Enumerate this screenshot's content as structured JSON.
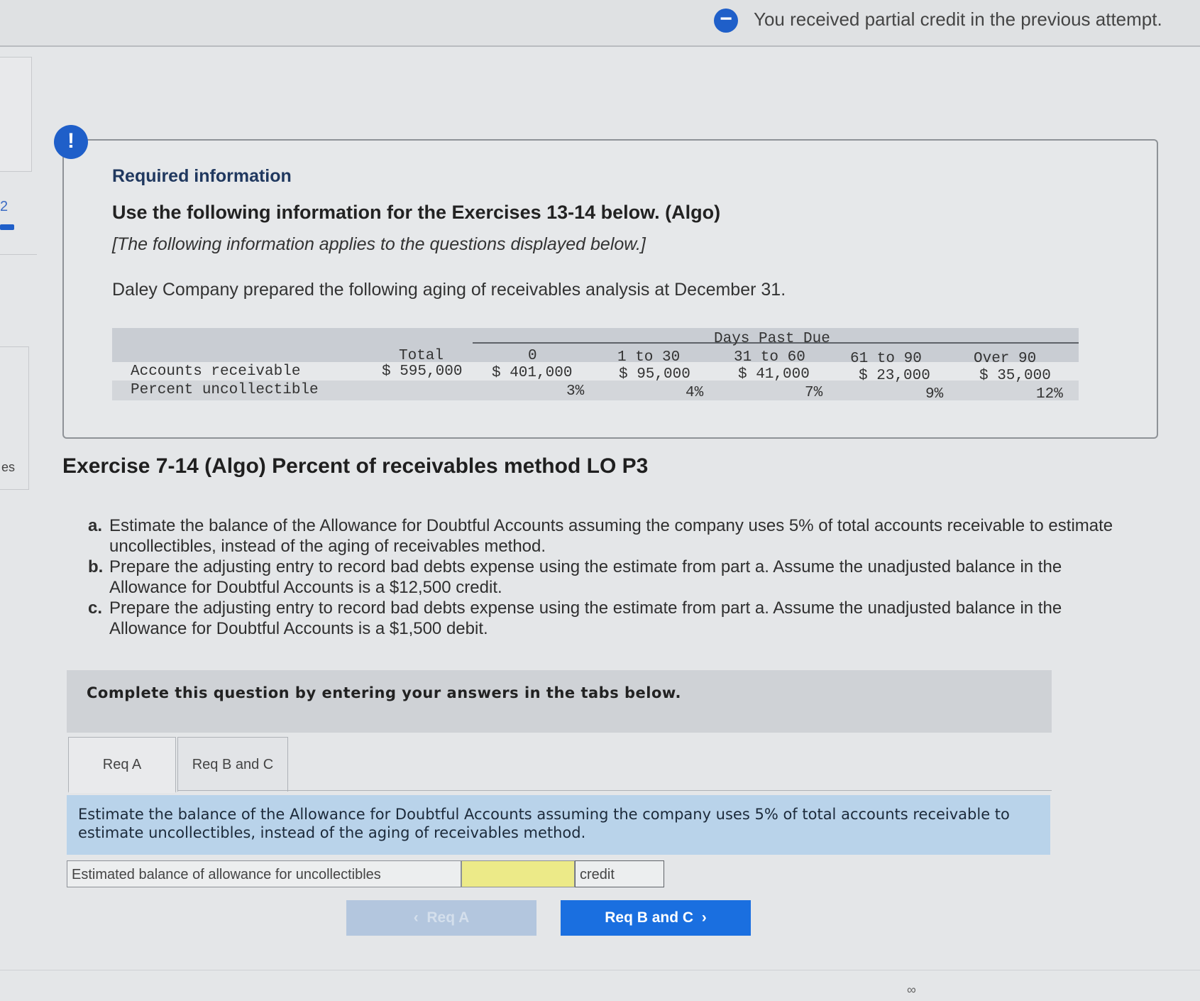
{
  "banner": {
    "icon": "minus-circle-icon",
    "icon_glyph": "−",
    "text": "You received partial credit in the previous attempt."
  },
  "sidebar": {
    "number": "2",
    "label": "es"
  },
  "info": {
    "icon_glyph": "!",
    "required": "Required information",
    "use": "Use the following information for the Exercises 13-14 below. (Algo)",
    "applies": "[The following information applies to the questions displayed below.]",
    "intro": "Daley Company prepared the following aging of receivables analysis at December 31."
  },
  "aging_table": {
    "group_header": "Days Past Due",
    "columns": [
      "Total",
      "0",
      "1 to 30",
      "31 to 60",
      "61 to 90",
      "Over 90"
    ],
    "rows": [
      {
        "label": "Accounts receivable",
        "values": [
          "$ 595,000",
          "$ 401,000",
          "$ 95,000",
          "$ 41,000",
          "$ 23,000",
          "$ 35,000"
        ]
      },
      {
        "label": "Percent uncollectible",
        "values": [
          "",
          "3%",
          "4%",
          "7%",
          "9%",
          "12%"
        ]
      }
    ]
  },
  "exercise": {
    "title": "Exercise 7-14 (Algo) Percent of receivables method LO P3",
    "parts": [
      {
        "letter": "a.",
        "text": "Estimate the balance of the Allowance for Doubtful Accounts assuming the company uses 5% of total accounts receivable to estimate uncollectibles, instead of the aging of receivables method."
      },
      {
        "letter": "b.",
        "text": "Prepare the adjusting entry to record bad debts expense using the estimate from part a. Assume the unadjusted balance in the Allowance for Doubtful Accounts is a $12,500 credit."
      },
      {
        "letter": "c.",
        "text": "Prepare the adjusting entry to record bad debts expense using the estimate from part a. Assume the unadjusted balance in the Allowance for Doubtful Accounts is a $1,500 debit."
      }
    ]
  },
  "complete_prompt": "Complete this question by entering your answers in the tabs below.",
  "tabs": [
    {
      "label": "Req A"
    },
    {
      "label": "Req B and C"
    }
  ],
  "instruction": "Estimate the balance of the Allowance for Doubtful Accounts assuming the company uses 5% of total accounts receivable to estimate uncollectibles, instead of the aging of receivables method.",
  "answer": {
    "label": "Estimated balance of allowance for uncollectibles",
    "value": "",
    "unit": "credit"
  },
  "nav": {
    "prev": "Req A",
    "next": "Req B and C"
  },
  "colors": {
    "accent": "#1a6fe0",
    "input_highlight": "#ecea88",
    "instruction_band": "#b9d3ea"
  }
}
